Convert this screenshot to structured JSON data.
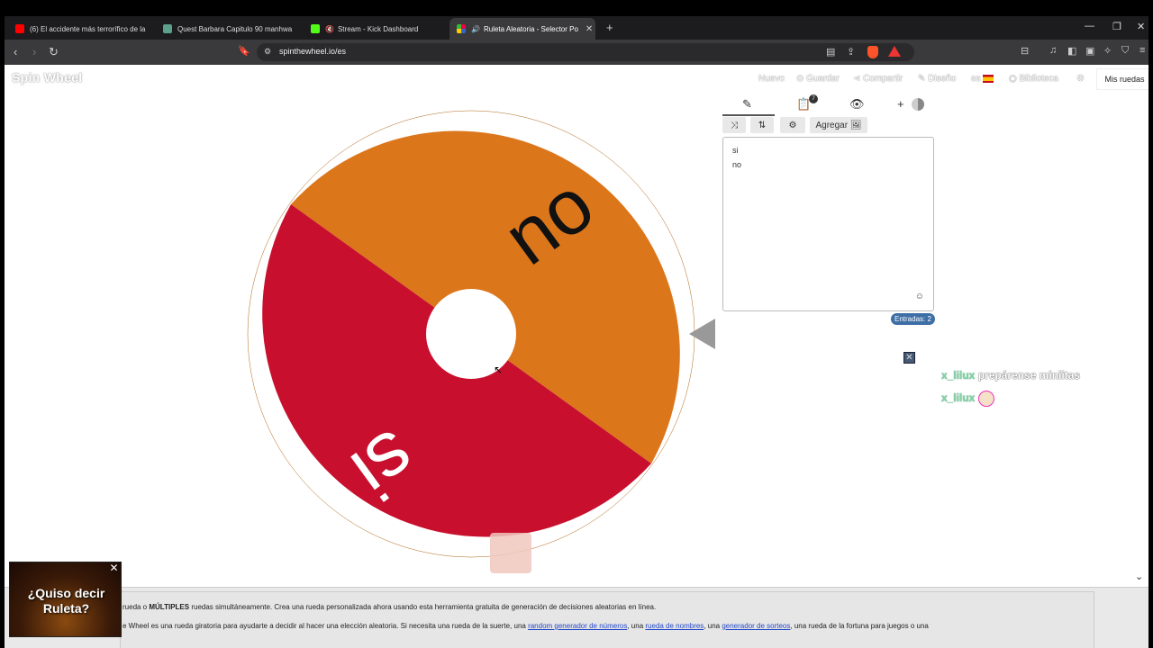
{
  "tabs": [
    {
      "title": "(6) El accidente más terrorífico de la",
      "favicon_color": "#ff0000",
      "active": false
    },
    {
      "title": "Quest Barbara Capitulo 90 manhwa",
      "favicon_color": "#5aa08a",
      "active": false
    },
    {
      "title": "Stream - Kick Dashboard",
      "favicon_color": "#53fc18",
      "active": false
    },
    {
      "title": "Ruleta Aleatoria - Selector Po",
      "favicon_color": "#e04",
      "active": true
    }
  ],
  "address_bar": {
    "url": "spinthewheel.io/es",
    "brave_badge": "3"
  },
  "site": {
    "logo": "Spin Wheel",
    "nav": {
      "nuevo": "Nuevo",
      "guardar": "Guardar",
      "compartir": "Compartir",
      "diseno": "Diseño",
      "lang": "es",
      "biblioteca": "Biblioteca",
      "mis_ruedas": "Mis ruedas"
    }
  },
  "wheel": {
    "segments": [
      {
        "label": "no",
        "color": "#dc761b"
      },
      {
        "label": "si",
        "color": "#c8102e"
      }
    ]
  },
  "panel": {
    "clipboard_badge": "7",
    "add_label": "Agregar",
    "entries": [
      "si",
      "no"
    ],
    "count_label": "Entradas: 2"
  },
  "chat": [
    {
      "user": "x_lilux",
      "message": "prepárense miniitas"
    },
    {
      "user": "x_lilux",
      "message": ""
    }
  ],
  "promo": {
    "line1": "¿Quiso decir",
    "line2": "Ruleta?"
  },
  "description": {
    "line1_pre": "rueda o ",
    "line1_bold": "MÚLTIPLES",
    "line1_post": " ruedas simultáneamente. Crea una rueda personalizada ahora usando esta herramienta gratuita de generación de decisiones aleatorias en línea.",
    "line2_pre": "e Wheel es una rueda giratoria para ayudarte a decidir al hacer una elección aleatoria. Si necesita una rueda de la suerte, una ",
    "link1": "random generador de números",
    "sep1": ", una ",
    "link2": "rueda de nombres",
    "sep2": ", una ",
    "link3": "generador de sorteos",
    "line2_post": ", una rueda de la fortuna para juegos o una"
  }
}
